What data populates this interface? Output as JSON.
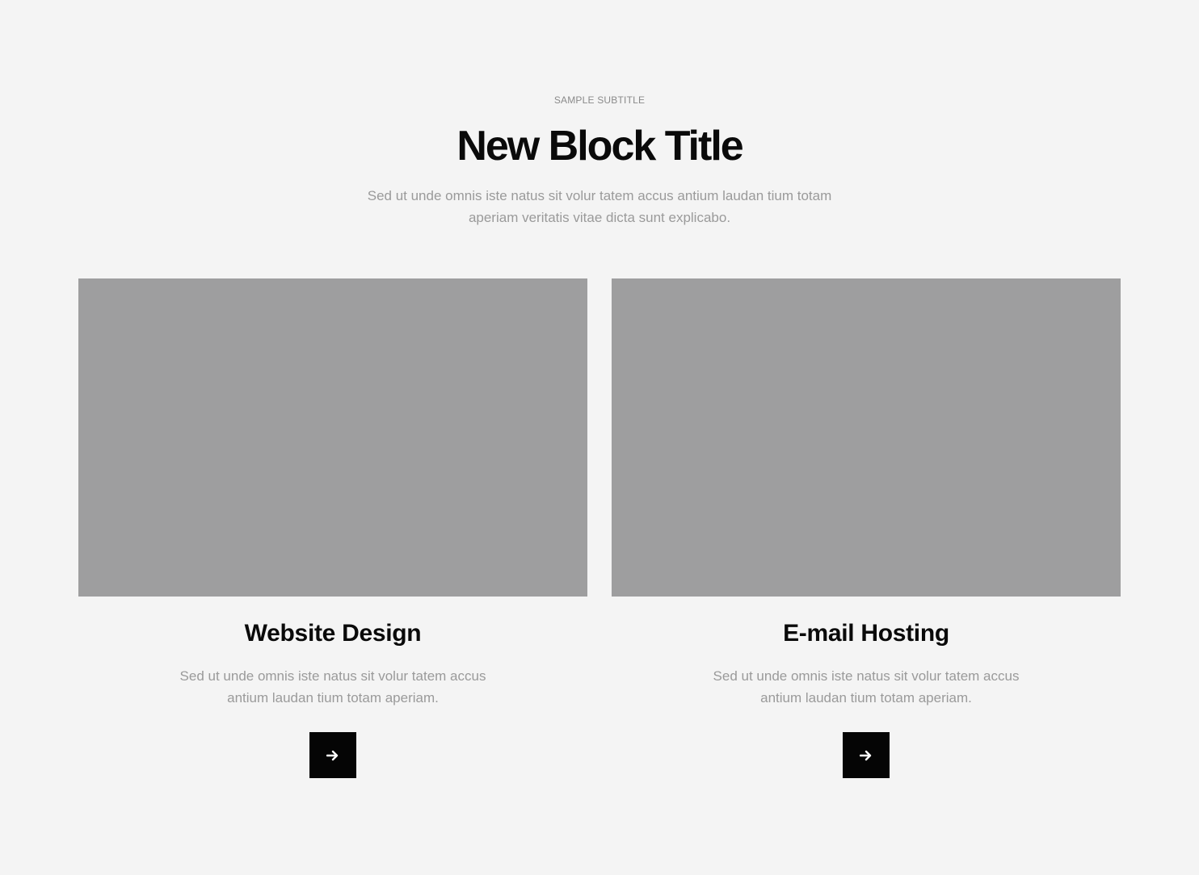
{
  "header": {
    "subtitle": "SAMPLE SUBTITLE",
    "title": "New Block Title",
    "description": "Sed ut unde omnis iste natus sit volur tatem accus antium laudan tium totam aperiam veritatis vitae dicta sunt explicabo."
  },
  "cards": [
    {
      "title": "Website Design",
      "text": "Sed ut unde omnis iste natus sit volur tatem accus antium laudan tium totam aperiam.",
      "button_icon": "arrow-right-icon"
    },
    {
      "title": "E-mail Hosting",
      "text": "Sed ut unde omnis iste natus sit volur tatem accus antium laudan tium totam aperiam.",
      "button_icon": "arrow-right-icon"
    }
  ],
  "colors": {
    "background": "#f4f4f4",
    "image_placeholder": "#9e9e9f",
    "heading": "#0a0a0a",
    "muted_text": "#9a9a9a",
    "button": "#050505",
    "button_icon": "#ffffff"
  }
}
